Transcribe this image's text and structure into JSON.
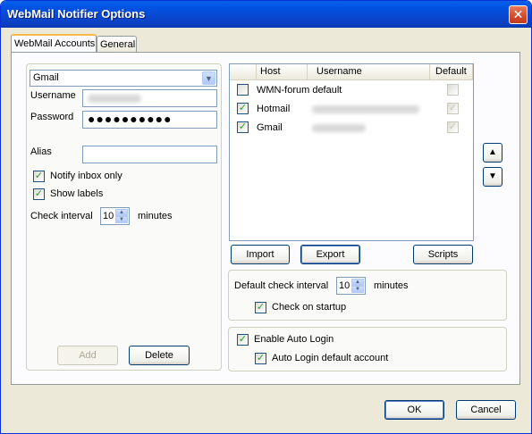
{
  "window": {
    "title": "WebMail Notifier Options",
    "close_glyph": "✕"
  },
  "tabs": [
    {
      "label": "WebMail Accounts",
      "active": true
    },
    {
      "label": "General",
      "active": false
    }
  ],
  "account": {
    "provider": "Gmail",
    "username_label": "Username",
    "password_label": "Password",
    "password_value": "●●●●●●●●●●",
    "alias_label": "Alias",
    "alias_value": "",
    "notify_inbox_label": "Notify inbox only",
    "notify_inbox_checked": true,
    "show_labels_label": "Show labels",
    "show_labels_checked": true,
    "check_interval_label": "Check interval",
    "check_interval_value": "10",
    "minutes_label": "minutes",
    "add_label": "Add",
    "delete_label": "Delete"
  },
  "accounts_list": {
    "columns": [
      "Host",
      "Username",
      "Default"
    ],
    "rows": [
      {
        "checked": false,
        "host": "WMN-forum default",
        "username": "",
        "default": false
      },
      {
        "checked": true,
        "host": "Hotmail",
        "username": "",
        "default": true
      },
      {
        "checked": true,
        "host": "Gmail",
        "username": "",
        "default": true
      }
    ]
  },
  "arrows": {
    "up": "▲",
    "down": "▼"
  },
  "list_buttons": {
    "import_label": "Import",
    "export_label": "Export",
    "scripts_label": "Scripts"
  },
  "defaults": {
    "interval_label": "Default check interval",
    "interval_value": "10",
    "minutes_label": "minutes",
    "startup_label": "Check on startup",
    "startup_checked": true
  },
  "autologin": {
    "enable_label": "Enable Auto Login",
    "enable_checked": true,
    "default_label": "Auto Login default account",
    "default_checked": true
  },
  "footer": {
    "ok_label": "OK",
    "cancel_label": "Cancel"
  },
  "check_glyph": "✓"
}
